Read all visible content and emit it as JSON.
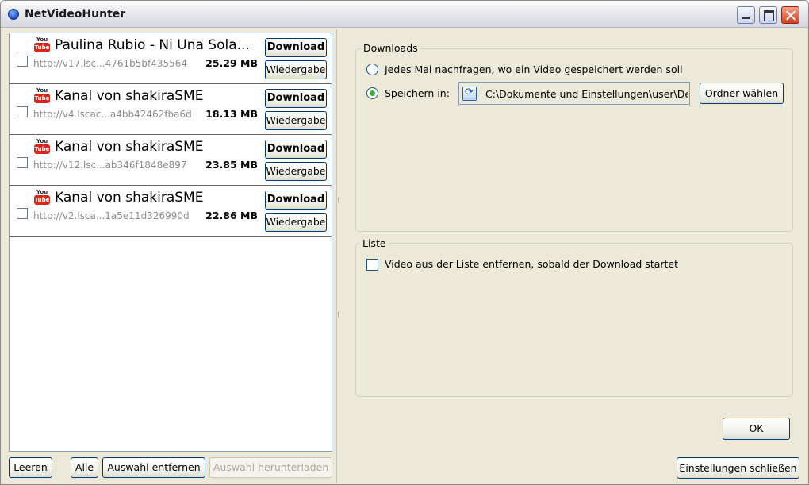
{
  "window": {
    "title": "NetVideoHunter"
  },
  "list": {
    "items": [
      {
        "source": "YouTube",
        "title": "Paulina Rubio - Ni Una Sola...",
        "url": "http://v17.lsc...4761b5bf435564",
        "size": "25.29 MB",
        "download_label": "Download",
        "play_label": "Wiedergabe",
        "checked": false
      },
      {
        "source": "YouTube",
        "title": "Kanal von shakiraSME",
        "url": "http://v4.lscac...a4bb42462fba6d",
        "size": "18.13 MB",
        "download_label": "Download",
        "play_label": "Wiedergabe",
        "checked": false
      },
      {
        "source": "YouTube",
        "title": "Kanal von shakiraSME",
        "url": "http://v12.lsc...ab346f1848e897",
        "size": "23.85 MB",
        "download_label": "Download",
        "play_label": "Wiedergabe",
        "checked": false
      },
      {
        "source": "YouTube",
        "title": "Kanal von shakiraSME",
        "url": "http://v2.lsca...1a5e11d326990d",
        "size": "22.86 MB",
        "download_label": "Download",
        "play_label": "Wiedergabe",
        "checked": false
      }
    ]
  },
  "list_buttons": {
    "clear": "Leeren",
    "all": "Alle",
    "remove_selection": "Auswahl entfernen",
    "download_selection": "Auswahl herunterladen"
  },
  "settings": {
    "downloads": {
      "legend": "Downloads",
      "ask_each_time": "Jedes Mal nachfragen, wo ein Video gespeichert werden soll",
      "save_in": "Speichern in:",
      "save_path": "C:\\Dokumente und Einstellungen\\user\\Des",
      "choose_folder": "Ordner wählen",
      "selected_option": "save_in"
    },
    "list": {
      "legend": "Liste",
      "remove_on_download": "Video aus der Liste entfernen, sobald der Download startet",
      "remove_on_download_checked": false
    },
    "ok": "OK",
    "close_settings": "Einstellungen schließen"
  },
  "icons": {
    "youtube_you": "You",
    "youtube_tube": "Tube"
  },
  "colors": {
    "window_bg": "#ece9d8",
    "youtube_red": "#d6261d",
    "url_gray": "#8c8c8c"
  }
}
